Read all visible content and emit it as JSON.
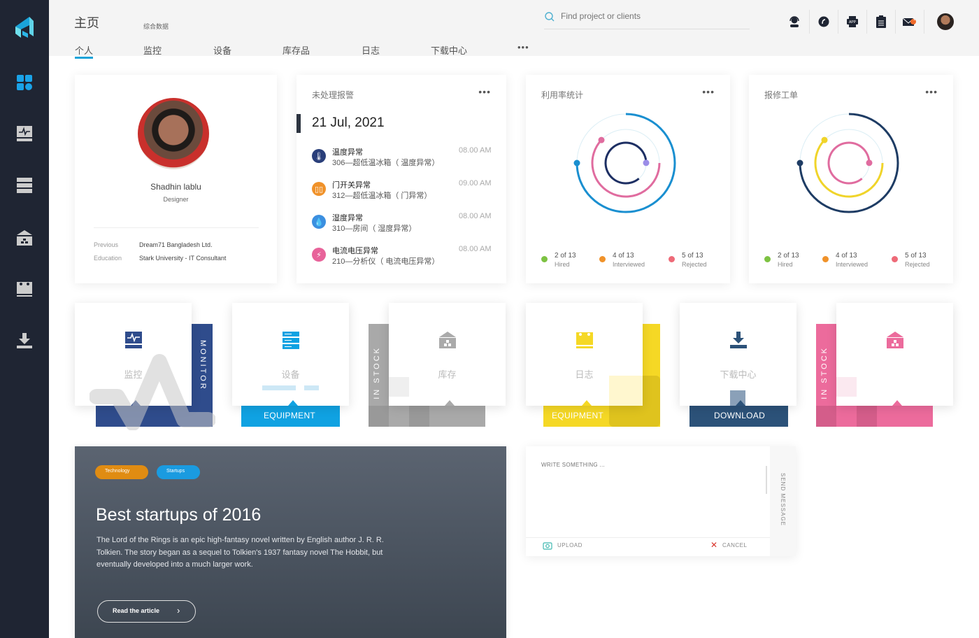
{
  "sidebar": {
    "items": [
      {
        "name": "logo",
        "icon": "logo-icon"
      },
      {
        "name": "dashboard",
        "icon": "grid-icon",
        "active": true
      },
      {
        "name": "monitor",
        "icon": "monitor-icon"
      },
      {
        "name": "equipment",
        "icon": "server-icon"
      },
      {
        "name": "stock",
        "icon": "warehouse-icon"
      },
      {
        "name": "log",
        "icon": "calendar-icon"
      },
      {
        "name": "download",
        "icon": "download-icon"
      }
    ]
  },
  "header": {
    "title": "主页",
    "subtitle": "综合数据",
    "tabs": [
      {
        "label": "个人",
        "active": true
      },
      {
        "label": "监控"
      },
      {
        "label": "设备"
      },
      {
        "label": "库存品"
      },
      {
        "label": "日志"
      },
      {
        "label": "下载中心"
      }
    ],
    "more": "•••",
    "search": {
      "placeholder": "Find project or clients"
    },
    "icons": [
      "support-icon",
      "link-icon",
      "app-icon",
      "clipboard-icon",
      "mail-icon",
      "avatar"
    ],
    "mail_badge": "1"
  },
  "profile": {
    "name": "Shadhin lablu",
    "role": "Designer",
    "rows": [
      {
        "label": "Previous",
        "value": "Dream71 Bangladesh Ltd."
      },
      {
        "label": "Education",
        "value": "Stark University - IT Consultant"
      }
    ]
  },
  "alerts": {
    "title": "未处理报警",
    "more": "•••",
    "date": "21 Jul, 2021",
    "items": [
      {
        "title": "温度异常",
        "desc": "306—超低温冰箱（ 温度异常）",
        "time": "08.00 AM",
        "color": "#2a3f7a",
        "icon": "thermometer-icon"
      },
      {
        "title": "门开关异常",
        "desc": "312—超低温冰箱（ 门异常）",
        "time": "09.00 AM",
        "color": "#f0922a",
        "icon": "door-icon"
      },
      {
        "title": "湿度异常",
        "desc": "310—房间（ 湿度异常）",
        "time": "08.00 AM",
        "color": "#3b8fe0",
        "icon": "droplet-icon"
      },
      {
        "title": "电流电压异常",
        "desc": "210—分析仪（ 电流电压异常）",
        "time": "08.00 AM",
        "color": "#e8639a",
        "icon": "lightning-icon"
      }
    ]
  },
  "utilization": {
    "title": "利用率统计",
    "more": "•••",
    "rings": [
      {
        "color": "#1a8fd0",
        "progress": 0.75,
        "dot": "#1a8fd0"
      },
      {
        "color": "#e06c9f",
        "progress": 0.62,
        "dot": "#e06c9f"
      },
      {
        "color": "#1d2f63",
        "progress": 0.86,
        "dot": "#9b8de8"
      }
    ],
    "legend": [
      {
        "value": "2 of 13",
        "label": "Hired",
        "color": "#7dc242"
      },
      {
        "value": "4 of 13",
        "label": "Interviewed",
        "color": "#f0922a"
      },
      {
        "value": "5 of 13",
        "label": "Rejected",
        "color": "#ee6a78"
      }
    ]
  },
  "repair": {
    "title": "报修工单",
    "more": "•••",
    "rings": [
      {
        "color": "#1e3c64",
        "progress": 0.75,
        "dot": "#1e3c64"
      },
      {
        "color": "#f0d42a",
        "progress": 0.62,
        "dot": "#f0d42a"
      },
      {
        "color": "#e06c9f",
        "progress": 0.86,
        "dot": "#e06c9f"
      }
    ],
    "legend": [
      {
        "value": "2 of 13",
        "label": "Hired",
        "color": "#7dc242"
      },
      {
        "value": "4 of 13",
        "label": "Interviewed",
        "color": "#f0922a"
      },
      {
        "value": "5 of 13",
        "label": "Rejected",
        "color": "#ee6a78"
      }
    ]
  },
  "tiles": [
    {
      "label": "监控",
      "tag": "MONITOR",
      "color": "#2f4c8c",
      "icon": "monitor-icon"
    },
    {
      "label": "设备",
      "tag": "EQUIPMENT",
      "color": "#10a2e2",
      "icon": "server-icon"
    },
    {
      "label": "库存",
      "tag": "IN STOCK",
      "color": "#a9a9a9",
      "icon": "warehouse-icon"
    },
    {
      "label": "日志",
      "tag": "EQUIPMENT",
      "color": "#f5d825",
      "icon": "calendar-icon"
    },
    {
      "label": "下载中心",
      "tag": "DOWNLOAD",
      "color": "#2c5279",
      "icon": "download-icon"
    },
    {
      "label": "",
      "tag": "IN STOCK",
      "color": "#ec6b9c",
      "icon": "warehouse-icon"
    }
  ],
  "article": {
    "tags": [
      {
        "label": "Technology",
        "color": "#e08c12"
      },
      {
        "label": "Startups",
        "color": "#1a9be0"
      }
    ],
    "title": "Best startups of 2016",
    "body": "The Lord of the Rings is an epic high-fantasy novel written by English author J. R. R. Tolkien. The story began as a sequel to Tolkien's 1937 fantasy novel The Hobbit, but eventually developed into a much larger work.",
    "button": "Read the article"
  },
  "message": {
    "placeholder": "WRITE SOMETHING ...",
    "upload": "UPLOAD",
    "cancel": "CANCEL",
    "send": "SEND MESSAGE"
  }
}
